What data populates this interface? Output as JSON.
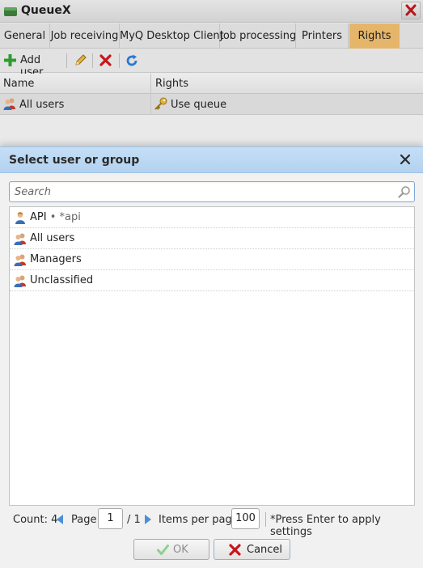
{
  "window": {
    "title": "QueueX"
  },
  "tabs": [
    {
      "label": "General"
    },
    {
      "label": "Job receiving"
    },
    {
      "label": "MyQ Desktop Client"
    },
    {
      "label": "Job processing"
    },
    {
      "label": "Printers"
    },
    {
      "label": "Rights",
      "active": true
    }
  ],
  "toolbar": {
    "add_user_label": "Add user",
    "icons": [
      "plus-icon",
      "pencil-icon",
      "delete-icon",
      "refresh-icon"
    ]
  },
  "grid": {
    "columns": [
      "Name",
      "Rights"
    ],
    "rows": [
      {
        "name": "All users",
        "rights": "Use queue"
      }
    ]
  },
  "dialog": {
    "title": "Select user or group",
    "search_placeholder": "Search",
    "items": [
      {
        "label": "API",
        "sub": " • *api",
        "icon": "user-icon"
      },
      {
        "label": "All users",
        "sub": "",
        "icon": "group-icon"
      },
      {
        "label": "Managers",
        "sub": "",
        "icon": "group-icon"
      },
      {
        "label": "Unclassified",
        "sub": "",
        "icon": "group-icon"
      }
    ],
    "pager": {
      "count_label": "Count: 4",
      "page_label": "Page:",
      "page_value": "1",
      "page_total": "/ 1",
      "items_per_page_label": "Items per page:",
      "items_per_page_value": "100",
      "hint": "*Press Enter to apply settings"
    },
    "ok_label": "OK",
    "cancel_label": "Cancel"
  },
  "colors": {
    "active_tab": "#e5b56a",
    "dialog_header": "#b3d2f0",
    "add_green": "#2e9b2e",
    "delete_red": "#c9151b",
    "refresh_blue": "#2a7ad2"
  }
}
